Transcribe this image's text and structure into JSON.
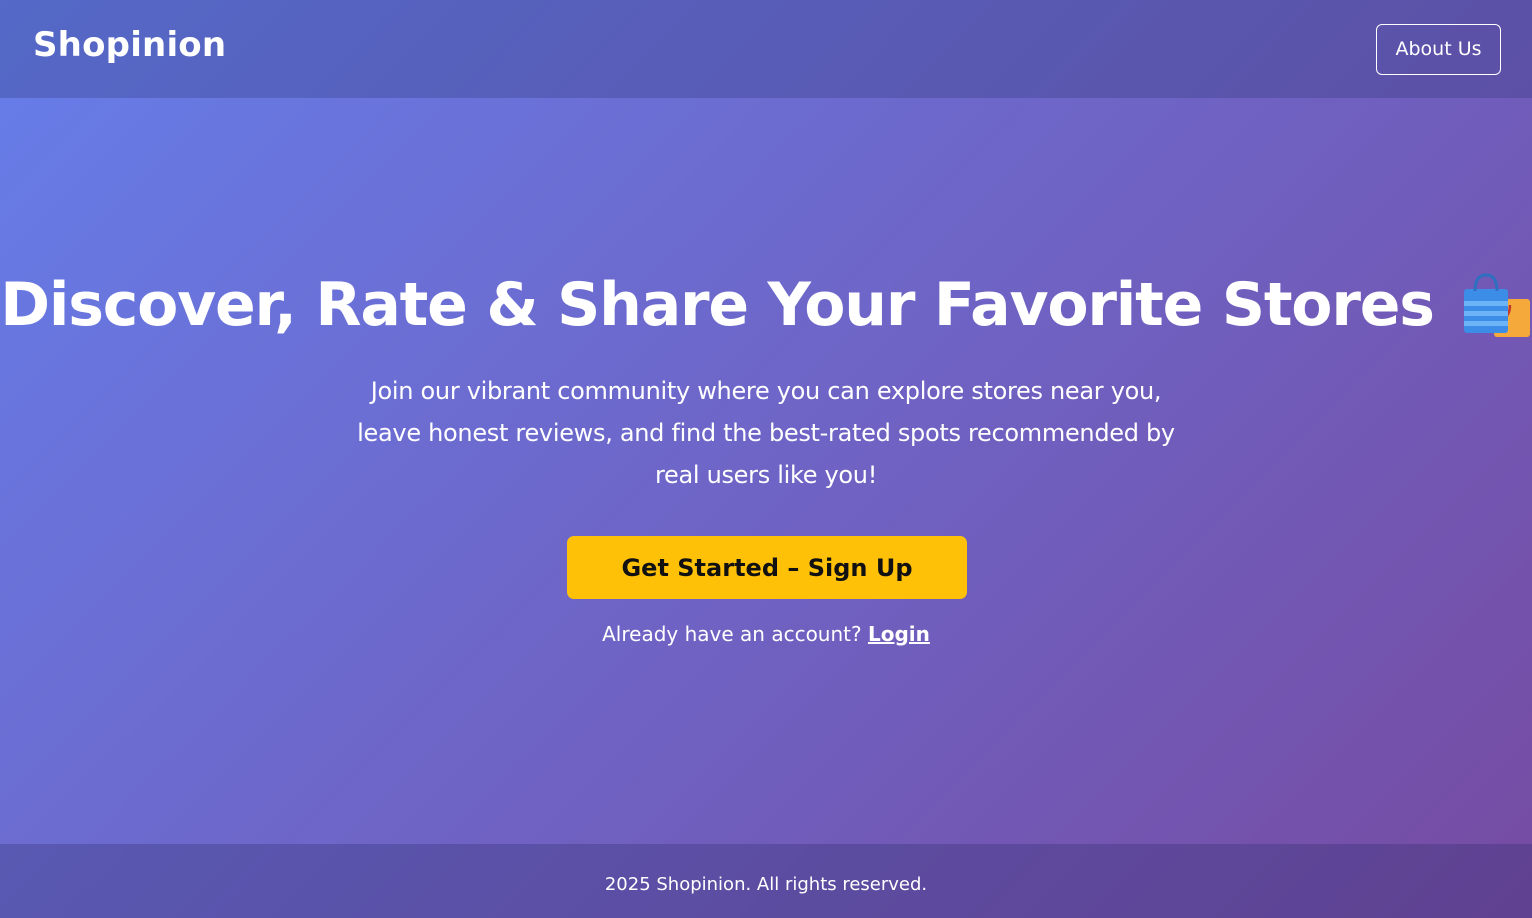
{
  "header": {
    "brand": "Shopinion",
    "about_label": "About Us"
  },
  "hero": {
    "title": "Discover, Rate & Share Your Favorite Stores",
    "title_icon": "shopping-bags-icon",
    "subtitle": "Join our vibrant community where you can explore stores near you, leave honest reviews, and find the best-rated spots recommended by real users like you!",
    "cta_label": "Get Started – Sign Up",
    "login_prompt": "Already have an account? ",
    "login_label": "Login"
  },
  "footer": {
    "copyright": "2025 Shopinion. All rights reserved."
  },
  "colors": {
    "gradient_start": "#667eea",
    "gradient_end": "#764ba2",
    "cta_background": "#ffc107",
    "text": "#ffffff"
  }
}
